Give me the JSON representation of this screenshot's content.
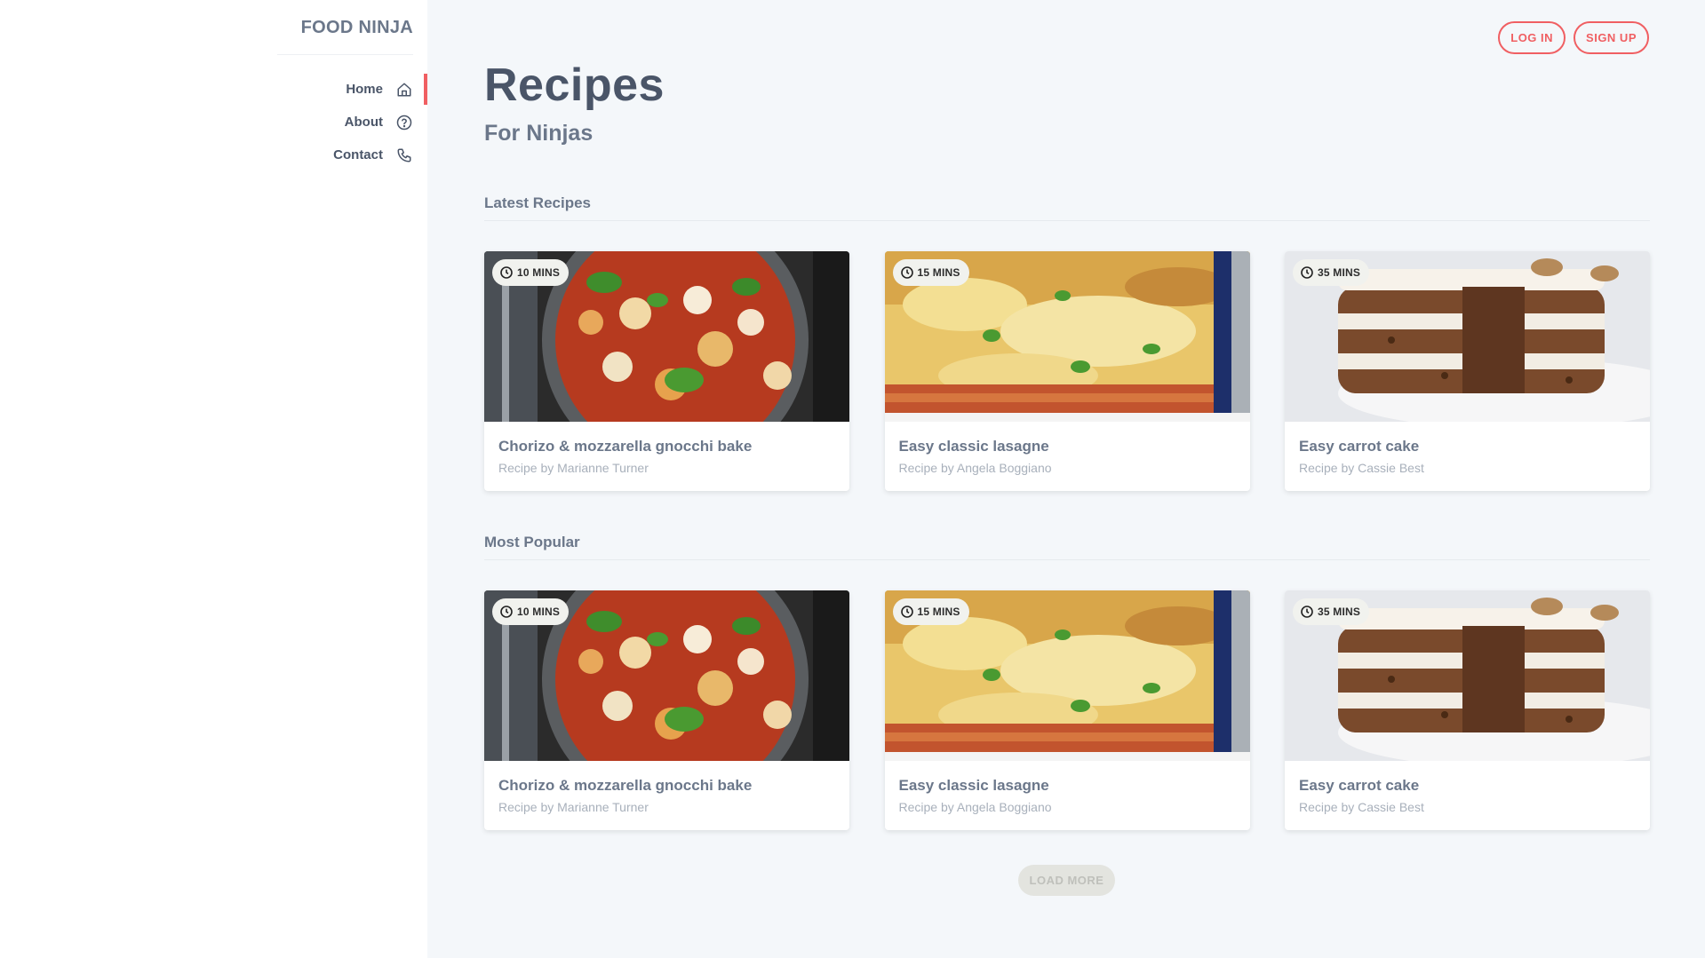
{
  "brand": "FOOD NINJA",
  "nav": [
    {
      "label": "Home",
      "icon": "home-icon",
      "active": true
    },
    {
      "label": "About",
      "icon": "help-circle-icon",
      "active": false
    },
    {
      "label": "Contact",
      "icon": "phone-icon",
      "active": false
    }
  ],
  "auth": {
    "login_label": "LOG IN",
    "signup_label": "SIGN UP"
  },
  "header": {
    "title": "Recipes",
    "subtitle": "For Ninjas"
  },
  "sections": [
    {
      "heading": "Latest Recipes",
      "cards": [
        {
          "time": "10 MINS",
          "title": "Chorizo & mozzarella gnocchi bake",
          "author": "Recipe by Marianne Turner",
          "image": "gnocchi-bake"
        },
        {
          "time": "15 MINS",
          "title": "Easy classic lasagne",
          "author": "Recipe by Angela Boggiano",
          "image": "lasagne"
        },
        {
          "time": "35 MINS",
          "title": "Easy carrot cake",
          "author": "Recipe by Cassie Best",
          "image": "carrot-cake"
        }
      ]
    },
    {
      "heading": "Most Popular",
      "cards": [
        {
          "time": "10 MINS",
          "title": "Chorizo & mozzarella gnocchi bake",
          "author": "Recipe by Marianne Turner",
          "image": "gnocchi-bake"
        },
        {
          "time": "15 MINS",
          "title": "Easy classic lasagne",
          "author": "Recipe by Angela Boggiano",
          "image": "lasagne"
        },
        {
          "time": "35 MINS",
          "title": "Easy carrot cake",
          "author": "Recipe by Cassie Best",
          "image": "carrot-cake"
        }
      ]
    }
  ],
  "load_more_label": "LOAD MORE",
  "colors": {
    "accent": "#f05f62",
    "text_dark": "#4a5568",
    "text_muted": "#6b778a",
    "background": "#f4f7fa"
  }
}
